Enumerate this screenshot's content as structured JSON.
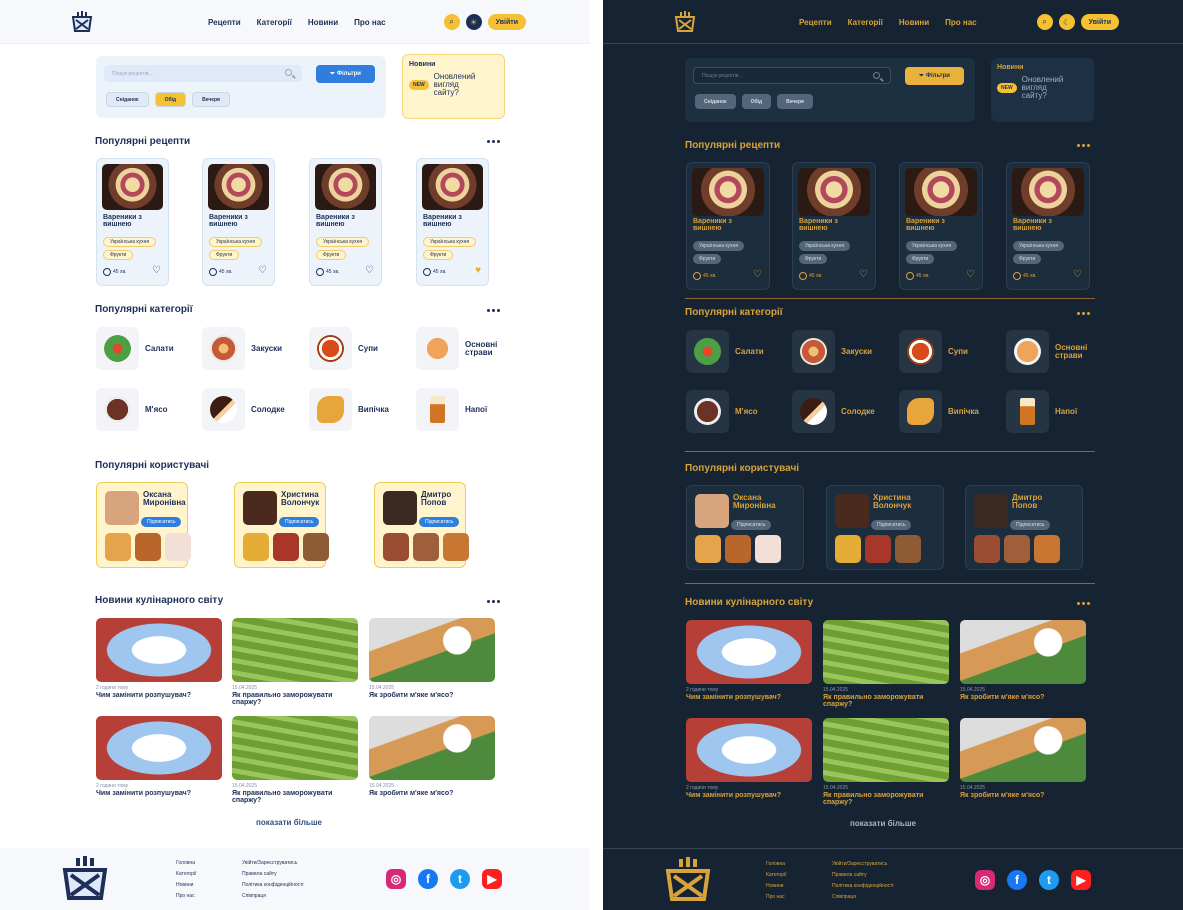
{
  "nav": {
    "items": [
      "Рецепти",
      "Категорії",
      "Новини",
      "Про нас"
    ],
    "login": "Увійти"
  },
  "search": {
    "placeholder": "Пошук рецептів...",
    "filter": "Фільтри",
    "pills": [
      "Сніданок",
      "Обід",
      "Вечеря"
    ]
  },
  "newsWidget": {
    "title": "Новини",
    "badge": "NEW",
    "text": "Оновлений вигляд сайту?"
  },
  "sections": {
    "popularRecipes": "Популярні рецепти",
    "popularCategories": "Популярні категорії",
    "popularUsers": "Популярні користувачі",
    "news": "Новини кулінарного світу",
    "showMore": "показати більше"
  },
  "recipes": [
    {
      "name": "Вареники з вишнею",
      "tags": [
        "Українська кухня",
        "Фрукти"
      ],
      "time": "45 хв."
    },
    {
      "name": "Вареники з вишнею",
      "tags": [
        "Українська кухня",
        "Фрукти"
      ],
      "time": "45 хв."
    },
    {
      "name": "Вареники з вишнею",
      "tags": [
        "Українська кухня",
        "Фрукти"
      ],
      "time": "45 хв."
    },
    {
      "name": "Вареники з вишнею",
      "tags": [
        "Українська кухня",
        "Фрукти"
      ],
      "time": "45 хв."
    }
  ],
  "categories": [
    "Салати",
    "Закуски",
    "Супи",
    "Основні страви",
    "М'ясо",
    "Солодке",
    "Випічка",
    "Напої"
  ],
  "users": [
    {
      "name": "Оксана Миронівна",
      "button": "Підписатись"
    },
    {
      "name": "Христина Волончук",
      "button": "Підписатись"
    },
    {
      "name": "Дмитро Попов",
      "button": "Підписатись"
    }
  ],
  "news": [
    {
      "date": "2 години тому",
      "title": "Чим замінити розпушувач?"
    },
    {
      "date": "15.04.2025",
      "title": "Як правильно заморожувати спаржу?"
    },
    {
      "date": "15.04.2025",
      "title": "Як зробити м'яке м'ясо?"
    },
    {
      "date": "2 години тому",
      "title": "Чим замінити розпушувач?"
    },
    {
      "date": "15.04.2025",
      "title": "Як правильно заморожувати спаржу?"
    },
    {
      "date": "15.04.2025",
      "title": "Як зробити м'яке м'ясо?"
    }
  ],
  "footer": {
    "col1": [
      "Головна",
      "Категорії",
      "Новини",
      "Про нас"
    ],
    "col2": [
      "Увійти/Зареєструватись",
      "Правила сайту",
      "Політика конфіденційності",
      "Співпраця"
    ]
  },
  "colors": {
    "lightNavy": "#1d2f57",
    "lightCard": "#edf3fb",
    "yellow": "#f5c133",
    "blue": "#2f7ddc",
    "darkBg": "#162332",
    "darkCard": "#1c2d3e",
    "darkText": "#d9a33a"
  },
  "icons": {
    "search": "search-icon",
    "theme": "theme-toggle-icon",
    "filter": "filter-icon",
    "clock": "clock-icon",
    "heart": "heart-icon",
    "more": "more-dots-icon",
    "instagram": "instagram-icon",
    "facebook": "facebook-icon",
    "twitter": "twitter-icon",
    "youtube": "youtube-icon"
  }
}
